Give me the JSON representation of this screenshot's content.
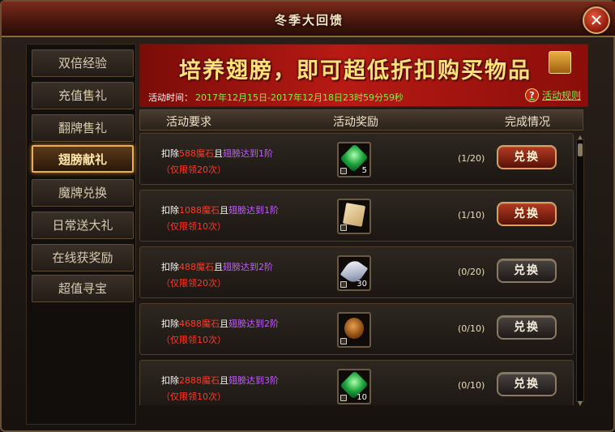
{
  "window": {
    "title": "冬季大回馈",
    "close_label": "✕"
  },
  "sidebar": {
    "items": [
      {
        "label": "双倍经验",
        "active": false
      },
      {
        "label": "充值售礼",
        "active": false
      },
      {
        "label": "翻牌售礼",
        "active": false
      },
      {
        "label": "翅膀献礼",
        "active": true
      },
      {
        "label": "魔牌兑换",
        "active": false
      },
      {
        "label": "日常送大礼",
        "active": false
      },
      {
        "label": "在线获奖励",
        "active": false
      },
      {
        "label": "超值寻宝",
        "active": false
      }
    ]
  },
  "banner": {
    "title": "培养翅膀，即可超低折扣购买物品",
    "time_label": "活动时间：",
    "time_value": "2017年12月15日-2017年12月18日23时59分59秒",
    "rules_link": "活动规则"
  },
  "table": {
    "headers": {
      "requirement": "活动要求",
      "reward": "活动奖励",
      "status": "完成情况"
    },
    "rows": [
      {
        "deduct": "扣除",
        "cost": "588魔石",
        "and": "且",
        "cond": "翅膀达到1阶",
        "limit": "（仅限领20次）",
        "item": "gem-green",
        "count": "5",
        "progress": "(1/20)",
        "button": "兑换",
        "enabled": true
      },
      {
        "deduct": "扣除",
        "cost": "1088魔石",
        "and": "且",
        "cond": "翅膀达到1阶",
        "limit": "（仅限领10次）",
        "item": "gem-scroll",
        "count": "",
        "progress": "(1/10)",
        "button": "兑换",
        "enabled": true
      },
      {
        "deduct": "扣除",
        "cost": "488魔石",
        "and": "且",
        "cond": "翅膀达到2阶",
        "limit": "（仅限领20次）",
        "item": "gem-feather",
        "count": "30",
        "progress": "(0/20)",
        "button": "兑换",
        "enabled": false
      },
      {
        "deduct": "扣除",
        "cost": "4688魔石",
        "and": "且",
        "cond": "翅膀达到2阶",
        "limit": "（仅限领10次）",
        "item": "gem-coin",
        "count": "",
        "progress": "(0/10)",
        "button": "兑换",
        "enabled": false
      },
      {
        "deduct": "扣除",
        "cost": "2888魔石",
        "and": "且",
        "cond": "翅膀达到3阶",
        "limit": "（仅限领10次）",
        "item": "gem-green",
        "count": "10",
        "progress": "(0/10)",
        "button": "兑换",
        "enabled": false
      }
    ]
  },
  "colors": {
    "accent_gold": "#e8b050",
    "banner_red": "#b81a14",
    "time_green": "#7cf04a",
    "cost_red": "#ff3a2a",
    "cond_purple": "#c25cff"
  }
}
